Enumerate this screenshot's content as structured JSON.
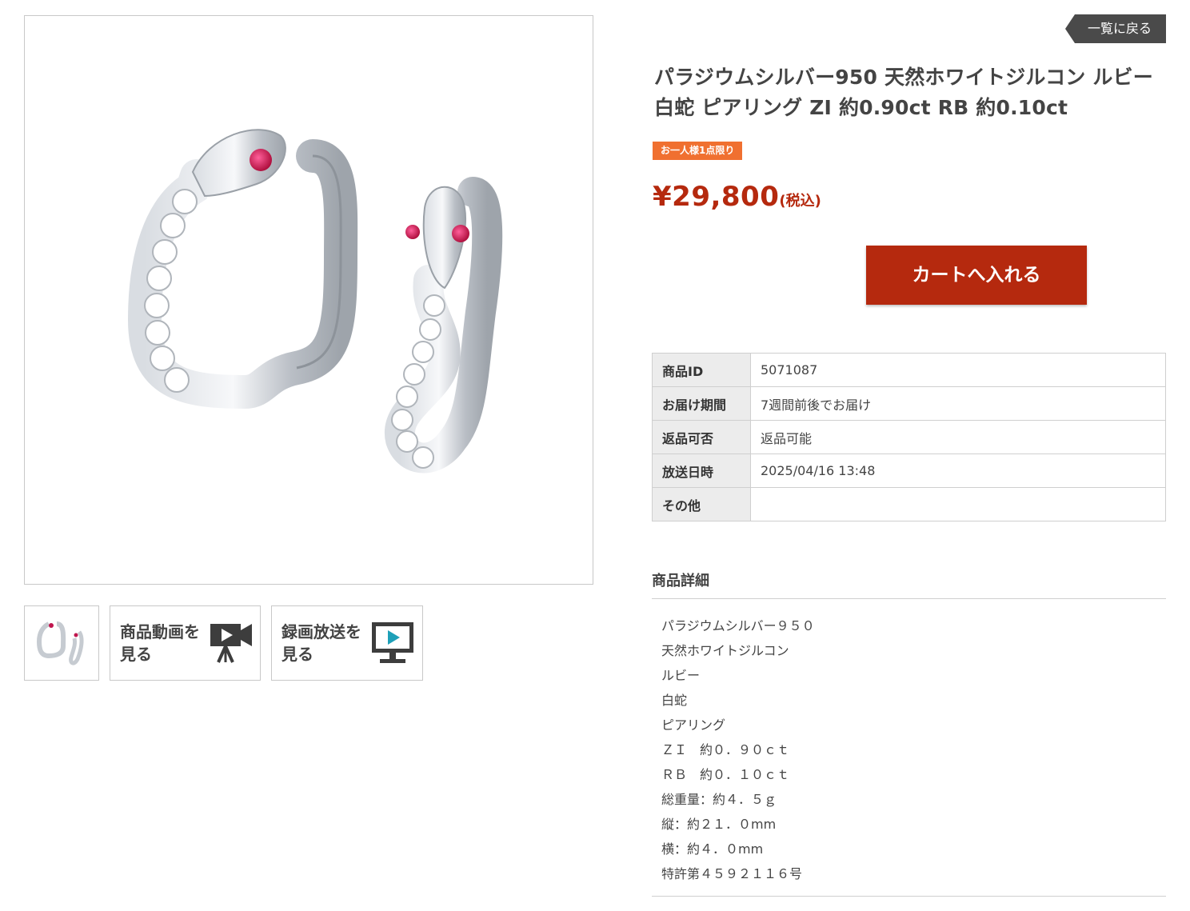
{
  "nav": {
    "back_label": "一覧に戻る"
  },
  "product": {
    "title_line1": "パラジウムシルバー950 天然ホワイトジルコン ルビー",
    "title_line2": "白蛇 ピアリング ZI 約0.90ct RB 約0.10ct",
    "badge": "お一人様1点限り",
    "price": "¥29,800",
    "price_tax_note": "(税込)",
    "cart_label": "カートへ入れる"
  },
  "gallery": {
    "main_image_icon": "snake-earrings-image",
    "thumbnails": [
      {
        "icon": "snake-earrings-thumbnail"
      },
      {
        "line1": "商品動画を",
        "line2": "見る",
        "icon": "video-camera-icon"
      },
      {
        "line1": "録画放送を",
        "line2": "見る",
        "icon": "monitor-play-icon"
      }
    ]
  },
  "specs": [
    {
      "label": "商品ID",
      "value": "5071087"
    },
    {
      "label": "お届け期間",
      "value": "7週間前後でお届け"
    },
    {
      "label": "返品可否",
      "value": "返品可能"
    },
    {
      "label": "放送日時",
      "value": "2025/04/16 13:48"
    },
    {
      "label": "その他",
      "value": ""
    }
  ],
  "details": {
    "heading": "商品詳細",
    "lines": [
      "パラジウムシルバー９５０",
      "天然ホワイトジルコン",
      "ルビー",
      "白蛇",
      "ピアリング",
      "ＺＩ　約０．９０ｃｔ",
      "ＲＢ　約０．１０ｃｔ",
      "総重量：約４．５ｇ",
      "縦：約２１．０mm",
      "横：約４．０mm",
      "特許第４５９２１１６号"
    ]
  },
  "colors": {
    "accent": "#b5290e",
    "badge": "#f07030",
    "back_button": "#4a4a4a"
  }
}
